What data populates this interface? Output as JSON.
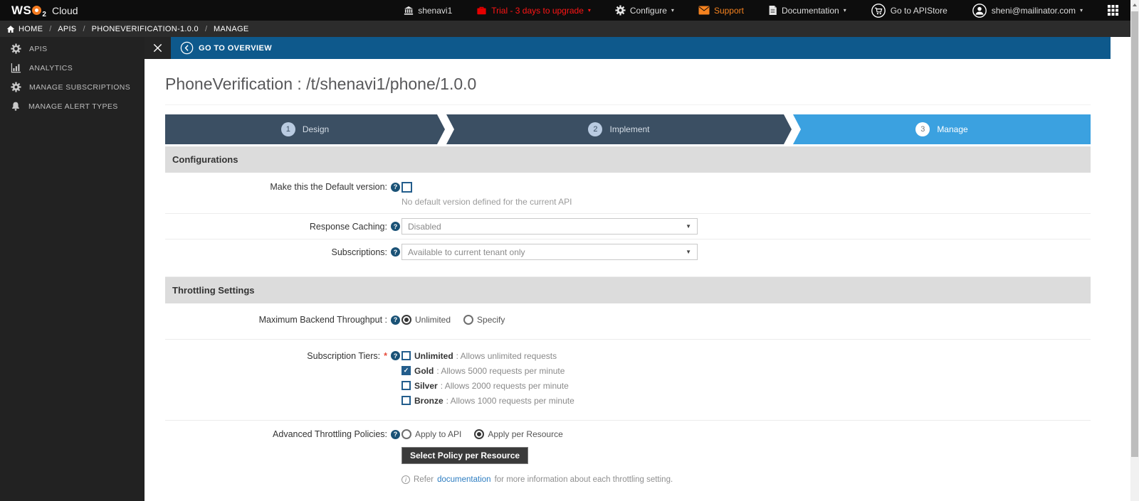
{
  "icons": {
    "help_glyph": "?",
    "check_glyph": "✓",
    "caret_glyph": "▾",
    "select_arrow": "▼",
    "info_glyph": "i"
  },
  "topbar": {
    "logo": {
      "ws": "WS",
      "two": "2",
      "product": "Cloud"
    },
    "tenant": "shenavi1",
    "trial": "Trial - 3 days to upgrade",
    "configure": "Configure",
    "support": "Support",
    "documentation": "Documentation",
    "apistore": "Go to APIStore",
    "user": "sheni@mailinator.com"
  },
  "breadcrumb": {
    "separator": "/",
    "items": [
      "HOME",
      "APIS",
      "PHONEVERIFICATION-1.0.0",
      "MANAGE"
    ]
  },
  "sidebar": {
    "items": [
      {
        "label": "APIS"
      },
      {
        "label": "ANALYTICS"
      },
      {
        "label": "MANAGE SUBSCRIPTIONS"
      },
      {
        "label": "MANAGE ALERT TYPES"
      }
    ]
  },
  "actionbar": {
    "go_to_overview": "GO TO OVERVIEW"
  },
  "page": {
    "title": "PhoneVerification : /t/shenavi1/phone/1.0.0"
  },
  "wizard": {
    "steps": [
      {
        "num": "1",
        "label": "Design"
      },
      {
        "num": "2",
        "label": "Implement"
      },
      {
        "num": "3",
        "label": "Manage"
      }
    ],
    "active_step": "Manage"
  },
  "sections": {
    "configurations": "Configurations",
    "throttling": "Throttling Settings"
  },
  "form": {
    "default_version": {
      "label": "Make this the Default version:",
      "checked": false,
      "helper": "No default version defined for the current API"
    },
    "response_caching": {
      "label": "Response Caching:",
      "value": "Disabled"
    },
    "subscriptions": {
      "label": "Subscriptions:",
      "value": "Available to current tenant only"
    },
    "max_backend": {
      "label": "Maximum Backend Throughput :",
      "options": [
        {
          "label": "Unlimited",
          "selected": true
        },
        {
          "label": "Specify",
          "selected": false
        }
      ]
    },
    "tiers": {
      "label": "Subscription Tiers:",
      "required": "*",
      "items": [
        {
          "name": "Unlimited",
          "desc": ": Allows unlimited requests",
          "checked": false
        },
        {
          "name": "Gold",
          "desc": ": Allows 5000 requests per minute",
          "checked": true
        },
        {
          "name": "Silver",
          "desc": ": Allows 2000 requests per minute",
          "checked": false
        },
        {
          "name": "Bronze",
          "desc": ": Allows 1000 requests per minute",
          "checked": false
        }
      ]
    },
    "advanced": {
      "label": "Advanced Throttling Policies:",
      "options": [
        {
          "label": "Apply to API",
          "selected": false
        },
        {
          "label": "Apply per Resource",
          "selected": true
        }
      ],
      "button": "Select Policy per Resource",
      "note_prefix": "Refer",
      "note_link": "documentation",
      "note_suffix": "for more information about each throttling setting."
    }
  },
  "colors": {
    "topbar_bg": "#0d0d0d",
    "breadcrumb_bg": "#2c2c2c",
    "sidebar_bg": "#222222",
    "action_blue": "#0e598c",
    "step_inactive": "#3b4f63",
    "step_active": "#3ba1e0",
    "section_header_bg": "#dcdcdc",
    "control_navy": "#235d8c",
    "trial_red": "#ff1515",
    "support_orange": "#f5821f",
    "link_blue": "#2d7dc1"
  }
}
